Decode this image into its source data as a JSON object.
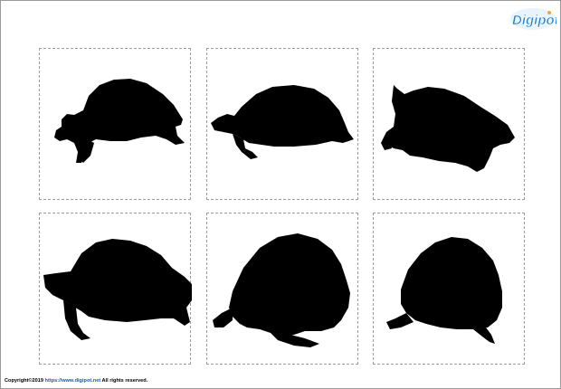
{
  "brand": {
    "logo_text": "Digipot",
    "accent_color": "#1e7fd0",
    "icon": "digipot-logo"
  },
  "cards": [
    {
      "subject": "turtle-silhouette-1",
      "fill": "#000000"
    },
    {
      "subject": "turtle-silhouette-2",
      "fill": "#000000"
    },
    {
      "subject": "turtle-silhouette-3",
      "fill": "#000000"
    },
    {
      "subject": "turtle-silhouette-4",
      "fill": "#000000"
    },
    {
      "subject": "turtle-silhouette-5",
      "fill": "#000000"
    },
    {
      "subject": "turtle-silhouette-6",
      "fill": "#000000"
    }
  ],
  "footer": {
    "copyright": "Copyright©2019 ",
    "url": "https://www.digipot.net",
    "rights": " All rights reserved."
  }
}
